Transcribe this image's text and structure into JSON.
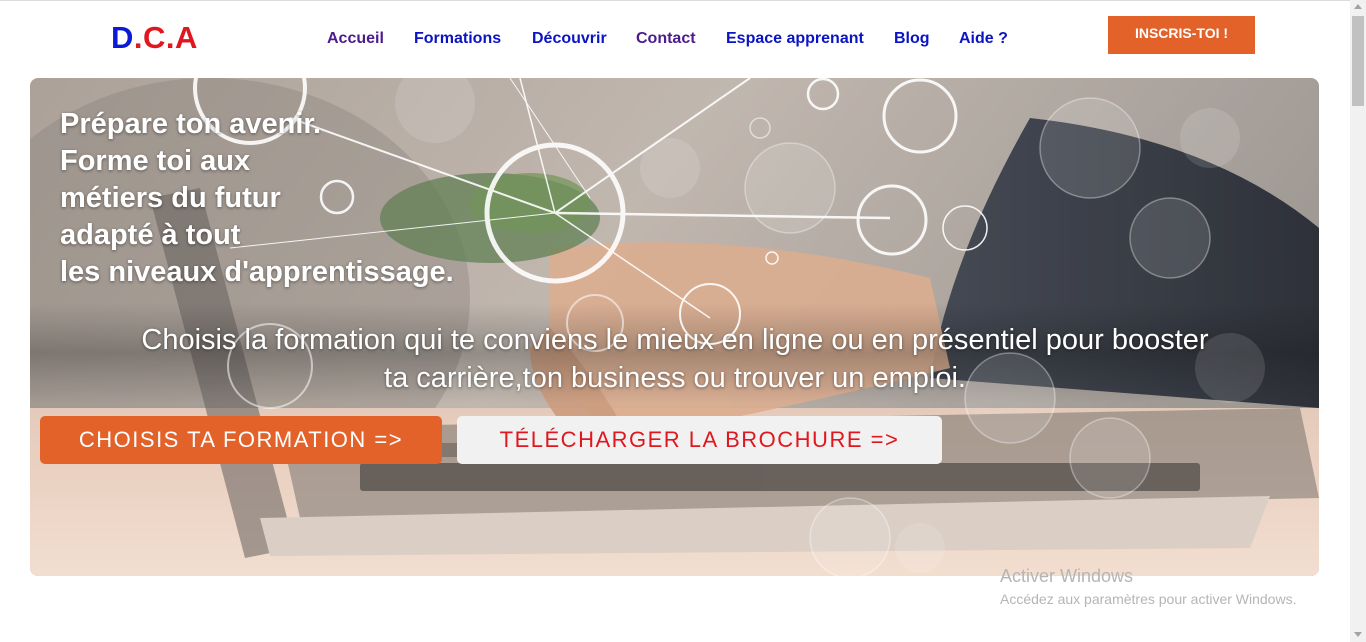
{
  "brand": {
    "d": "D",
    "dot1": ".",
    "c": "C",
    "dot2": ".A"
  },
  "nav": {
    "items": [
      {
        "label": "Accueil",
        "visited": true
      },
      {
        "label": "Formations",
        "visited": false
      },
      {
        "label": "Découvrir",
        "visited": false
      },
      {
        "label": "Contact",
        "visited": true
      },
      {
        "label": "Espace apprenant",
        "visited": false
      },
      {
        "label": "Blog",
        "visited": false
      },
      {
        "label": "Aide ?",
        "visited": false
      }
    ]
  },
  "header_cta": "INSCRIS-TOI !",
  "hero": {
    "headline": [
      "Prépare ton avenir.",
      "Forme toi aux",
      "métiers du futur",
      "adapté à tout",
      "les niveaux d'apprentissage."
    ],
    "subtitle_lines": [
      "Choisis la formation qui te conviens le mieux en ligne ou en présentiel pour booster",
      "ta carrière,ton business ou trouver un emploi."
    ],
    "primary_button": "CHOISIS TA FORMATION =>",
    "secondary_button": "TÉLÉCHARGER LA BROCHURE =>"
  },
  "watermark": {
    "title": "Activer Windows",
    "subtitle": "Accédez aux paramètres pour activer Windows."
  },
  "colors": {
    "accent_orange": "#e2622a",
    "brand_blue": "#0a1ad6",
    "brand_red": "#e0171e",
    "nav_link": "#0b14c4",
    "nav_visited": "#4b1c8c"
  }
}
